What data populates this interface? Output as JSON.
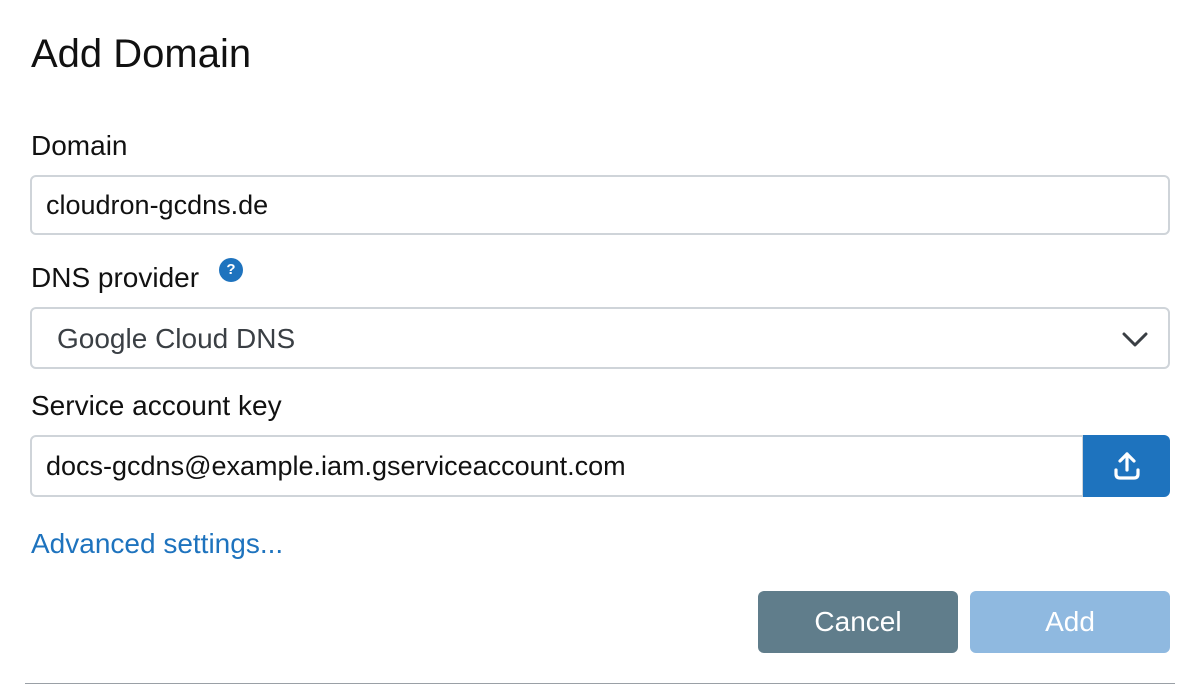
{
  "dialog": {
    "title": "Add Domain"
  },
  "form": {
    "domain_label": "Domain",
    "domain_value": "cloudron-gcdns.de",
    "provider_label": "DNS provider",
    "provider_help_icon": "?",
    "provider_selected": "Google Cloud DNS",
    "key_label": "Service account key",
    "key_value": "docs-gcdns@example.iam.gserviceaccount.com",
    "advanced_link": "Advanced settings..."
  },
  "actions": {
    "cancel_label": "Cancel",
    "add_label": "Add"
  },
  "colors": {
    "accent": "#1e73be",
    "cancel_bg": "#607d8b",
    "add_disabled_bg": "#8fb9e0",
    "border": "#cfd4d9"
  },
  "icons": {
    "help": "question-circle-icon",
    "dropdown": "chevron-down-icon",
    "upload": "upload-icon"
  }
}
